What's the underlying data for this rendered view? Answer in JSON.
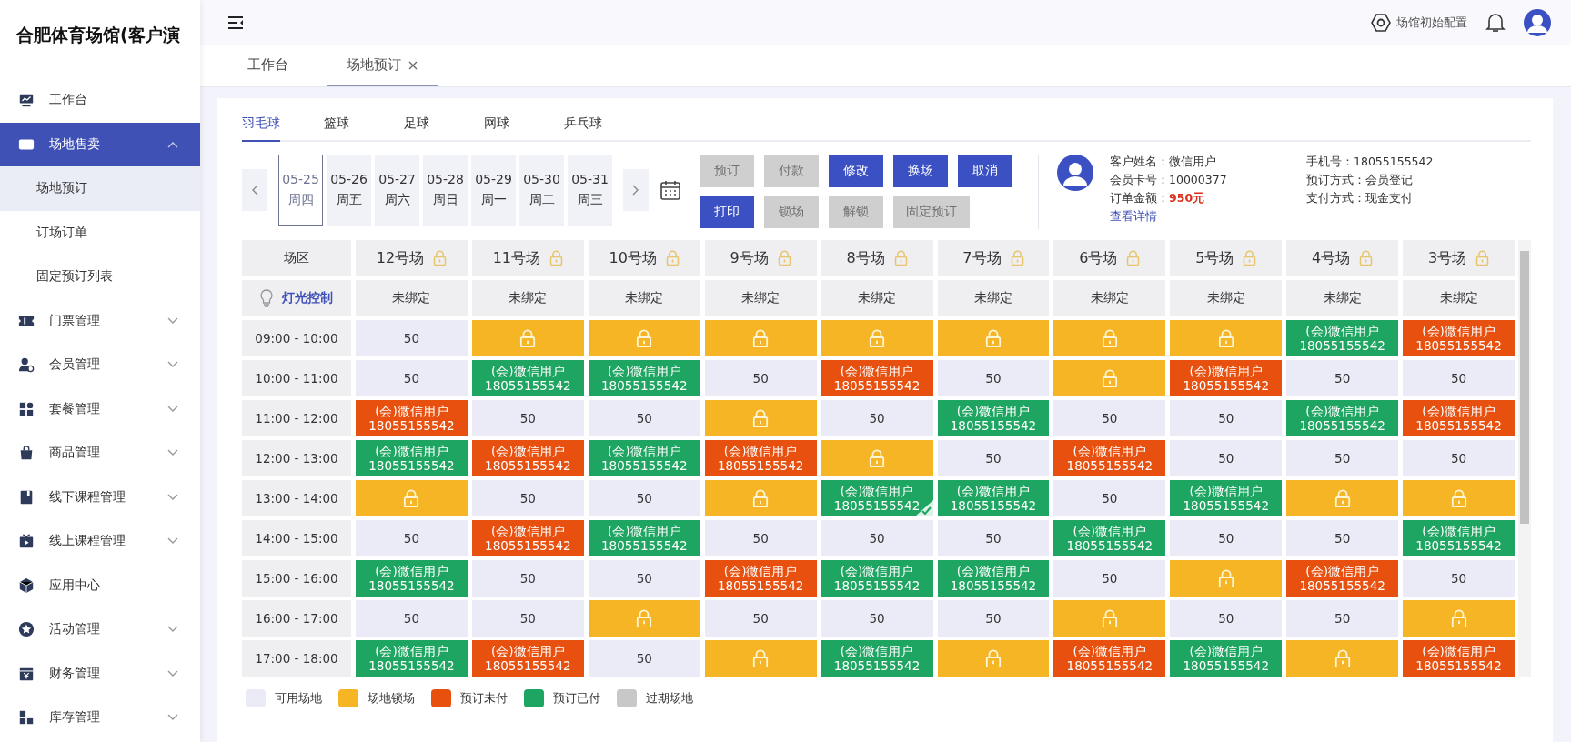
{
  "sidebar": {
    "title": "合肥体育场馆(客户演",
    "items": [
      {
        "label": "工作台",
        "selected": false
      },
      {
        "label": "场地售卖",
        "selected": true,
        "expanded": true,
        "children": [
          {
            "label": "场地预订",
            "selected": true
          },
          {
            "label": "订场订单",
            "selected": false
          },
          {
            "label": "固定预订列表",
            "selected": false
          }
        ]
      },
      {
        "label": "门票管理",
        "selected": false,
        "expanded": false
      },
      {
        "label": "会员管理",
        "selected": false,
        "expanded": false
      },
      {
        "label": "套餐管理",
        "selected": false,
        "expanded": false
      },
      {
        "label": "商品管理",
        "selected": false,
        "expanded": false
      },
      {
        "label": "线下课程管理",
        "selected": false,
        "expanded": false
      },
      {
        "label": "线上课程管理",
        "selected": false,
        "expanded": false
      },
      {
        "label": "应用中心",
        "selected": false
      },
      {
        "label": "活动管理",
        "selected": false,
        "expanded": false
      },
      {
        "label": "财务管理",
        "selected": false,
        "expanded": false
      },
      {
        "label": "库存管理",
        "selected": false,
        "expanded": false
      }
    ]
  },
  "header": {
    "config_label": "场馆初始配置"
  },
  "page_tabs": [
    {
      "label": "工作台",
      "selected": false,
      "closable": false
    },
    {
      "label": "场地预订",
      "selected": true,
      "closable": true
    }
  ],
  "sport_tabs": [
    {
      "label": "羽毛球",
      "selected": true
    },
    {
      "label": "篮球",
      "selected": false
    },
    {
      "label": "足球",
      "selected": false
    },
    {
      "label": "网球",
      "selected": false
    },
    {
      "label": "乒乓球",
      "selected": false
    }
  ],
  "dates": [
    {
      "date": "05-25",
      "weekday": "周四",
      "selected": true
    },
    {
      "date": "05-26",
      "weekday": "周五",
      "selected": false
    },
    {
      "date": "05-27",
      "weekday": "周六",
      "selected": false
    },
    {
      "date": "05-28",
      "weekday": "周日",
      "selected": false
    },
    {
      "date": "05-29",
      "weekday": "周一",
      "selected": false
    },
    {
      "date": "05-30",
      "weekday": "周二",
      "selected": false
    },
    {
      "date": "05-31",
      "weekday": "周三",
      "selected": false
    }
  ],
  "actions": [
    [
      {
        "label": "预订",
        "disabled": true
      },
      {
        "label": "付款",
        "disabled": true
      },
      {
        "label": "修改",
        "disabled": false
      },
      {
        "label": "换场",
        "disabled": false
      },
      {
        "label": "取消",
        "disabled": false
      }
    ],
    [
      {
        "label": "打印",
        "disabled": false
      },
      {
        "label": "锁场",
        "disabled": true
      },
      {
        "label": "解锁",
        "disabled": true
      },
      {
        "label": "固定预订",
        "disabled": true
      }
    ]
  ],
  "customer": {
    "left": [
      {
        "label": "客户姓名：",
        "value": "微信用户"
      },
      {
        "label": "会员卡号：",
        "value": "10000377"
      },
      {
        "label": "订单金额：",
        "value": "950元",
        "kind": "amount"
      }
    ],
    "right": [
      {
        "label": "手机号：",
        "value": "18055155542"
      },
      {
        "label": "预订方式：",
        "value": "会员登记"
      },
      {
        "label": "支付方式：",
        "value": "现金支付"
      }
    ],
    "link": "查看详情"
  },
  "grid": {
    "corner": "场区",
    "columns": [
      "12号场",
      "11号场",
      "10号场",
      "9号场",
      "8号场",
      "7号场",
      "6号场",
      "5号场",
      "4号场",
      "3号场"
    ],
    "light_label": "灯光控制",
    "bindings": [
      "未绑定",
      "未绑定",
      "未绑定",
      "未绑定",
      "未绑定",
      "未绑定",
      "未绑定",
      "未绑定",
      "未绑定",
      "未绑定"
    ],
    "rows": [
      {
        "time": "09:00 - 10:00",
        "cells": [
          {
            "kind": "available",
            "price": "50",
            "selected": false
          },
          {
            "kind": "locked",
            "selected": false
          },
          {
            "kind": "locked",
            "selected": false
          },
          {
            "kind": "locked",
            "selected": false
          },
          {
            "kind": "locked",
            "selected": false
          },
          {
            "kind": "locked",
            "selected": false
          },
          {
            "kind": "locked",
            "selected": false
          },
          {
            "kind": "locked",
            "selected": false
          },
          {
            "kind": "paid",
            "name": "(会)微信用户",
            "phone": "18055155542",
            "selected": false
          },
          {
            "kind": "unpaid",
            "name": "(会)微信用户",
            "phone": "18055155542",
            "selected": false
          }
        ]
      },
      {
        "time": "10:00 - 11:00",
        "cells": [
          {
            "kind": "available",
            "price": "50",
            "selected": false
          },
          {
            "kind": "paid",
            "name": "(会)微信用户",
            "phone": "18055155542",
            "selected": false
          },
          {
            "kind": "paid",
            "name": "(会)微信用户",
            "phone": "18055155542",
            "selected": false
          },
          {
            "kind": "available",
            "price": "50",
            "selected": false
          },
          {
            "kind": "unpaid",
            "name": "(会)微信用户",
            "phone": "18055155542",
            "selected": false
          },
          {
            "kind": "available",
            "price": "50",
            "selected": false
          },
          {
            "kind": "locked",
            "selected": false
          },
          {
            "kind": "unpaid",
            "name": "(会)微信用户",
            "phone": "18055155542",
            "selected": false
          },
          {
            "kind": "available",
            "price": "50",
            "selected": false
          },
          {
            "kind": "available",
            "price": "50",
            "selected": false
          }
        ]
      },
      {
        "time": "11:00 - 12:00",
        "cells": [
          {
            "kind": "unpaid",
            "name": "(会)微信用户",
            "phone": "18055155542",
            "selected": false
          },
          {
            "kind": "available",
            "price": "50",
            "selected": false
          },
          {
            "kind": "available",
            "price": "50",
            "selected": false
          },
          {
            "kind": "locked",
            "selected": false
          },
          {
            "kind": "available",
            "price": "50",
            "selected": false
          },
          {
            "kind": "paid",
            "name": "(会)微信用户",
            "phone": "18055155542",
            "selected": false
          },
          {
            "kind": "available",
            "price": "50",
            "selected": false
          },
          {
            "kind": "available",
            "price": "50",
            "selected": false
          },
          {
            "kind": "paid",
            "name": "(会)微信用户",
            "phone": "18055155542",
            "selected": false
          },
          {
            "kind": "unpaid",
            "name": "(会)微信用户",
            "phone": "18055155542",
            "selected": false
          }
        ]
      },
      {
        "time": "12:00 - 13:00",
        "cells": [
          {
            "kind": "paid",
            "name": "(会)微信用户",
            "phone": "18055155542",
            "selected": false
          },
          {
            "kind": "unpaid",
            "name": "(会)微信用户",
            "phone": "18055155542",
            "selected": false
          },
          {
            "kind": "paid",
            "name": "(会)微信用户",
            "phone": "18055155542",
            "selected": false
          },
          {
            "kind": "unpaid",
            "name": "(会)微信用户",
            "phone": "18055155542",
            "selected": false
          },
          {
            "kind": "locked",
            "selected": false
          },
          {
            "kind": "available",
            "price": "50",
            "selected": false
          },
          {
            "kind": "unpaid",
            "name": "(会)微信用户",
            "phone": "18055155542",
            "selected": false
          },
          {
            "kind": "available",
            "price": "50",
            "selected": false
          },
          {
            "kind": "available",
            "price": "50",
            "selected": false
          },
          {
            "kind": "available",
            "price": "50",
            "selected": false
          }
        ]
      },
      {
        "time": "13:00 - 14:00",
        "cells": [
          {
            "kind": "locked",
            "selected": false
          },
          {
            "kind": "available",
            "price": "50",
            "selected": false
          },
          {
            "kind": "available",
            "price": "50",
            "selected": false
          },
          {
            "kind": "locked",
            "selected": false
          },
          {
            "kind": "paid",
            "name": "(会)微信用户",
            "phone": "18055155542",
            "selected": true
          },
          {
            "kind": "paid",
            "name": "(会)微信用户",
            "phone": "18055155542",
            "selected": false
          },
          {
            "kind": "available",
            "price": "50",
            "selected": false
          },
          {
            "kind": "paid",
            "name": "(会)微信用户",
            "phone": "18055155542",
            "selected": false
          },
          {
            "kind": "locked",
            "selected": false
          },
          {
            "kind": "locked",
            "selected": false
          }
        ]
      },
      {
        "time": "14:00 - 15:00",
        "cells": [
          {
            "kind": "available",
            "price": "50",
            "selected": false
          },
          {
            "kind": "unpaid",
            "name": "(会)微信用户",
            "phone": "18055155542",
            "selected": false
          },
          {
            "kind": "paid",
            "name": "(会)微信用户",
            "phone": "18055155542",
            "selected": false
          },
          {
            "kind": "available",
            "price": "50",
            "selected": false
          },
          {
            "kind": "available",
            "price": "50",
            "selected": false
          },
          {
            "kind": "available",
            "price": "50",
            "selected": false
          },
          {
            "kind": "paid",
            "name": "(会)微信用户",
            "phone": "18055155542",
            "selected": false
          },
          {
            "kind": "available",
            "price": "50",
            "selected": false
          },
          {
            "kind": "available",
            "price": "50",
            "selected": false
          },
          {
            "kind": "paid",
            "name": "(会)微信用户",
            "phone": "18055155542",
            "selected": false
          }
        ]
      },
      {
        "time": "15:00 - 16:00",
        "cells": [
          {
            "kind": "paid",
            "name": "(会)微信用户",
            "phone": "18055155542",
            "selected": false
          },
          {
            "kind": "available",
            "price": "50",
            "selected": false
          },
          {
            "kind": "available",
            "price": "50",
            "selected": false
          },
          {
            "kind": "unpaid",
            "name": "(会)微信用户",
            "phone": "18055155542",
            "selected": false
          },
          {
            "kind": "paid",
            "name": "(会)微信用户",
            "phone": "18055155542",
            "selected": false
          },
          {
            "kind": "paid",
            "name": "(会)微信用户",
            "phone": "18055155542",
            "selected": false
          },
          {
            "kind": "available",
            "price": "50",
            "selected": false
          },
          {
            "kind": "locked",
            "selected": false
          },
          {
            "kind": "unpaid",
            "name": "(会)微信用户",
            "phone": "18055155542",
            "selected": false
          },
          {
            "kind": "available",
            "price": "50",
            "selected": false
          }
        ]
      },
      {
        "time": "16:00 - 17:00",
        "cells": [
          {
            "kind": "available",
            "price": "50",
            "selected": false
          },
          {
            "kind": "available",
            "price": "50",
            "selected": false
          },
          {
            "kind": "locked",
            "selected": false
          },
          {
            "kind": "available",
            "price": "50",
            "selected": false
          },
          {
            "kind": "available",
            "price": "50",
            "selected": false
          },
          {
            "kind": "available",
            "price": "50",
            "selected": false
          },
          {
            "kind": "locked",
            "selected": false
          },
          {
            "kind": "available",
            "price": "50",
            "selected": false
          },
          {
            "kind": "available",
            "price": "50",
            "selected": false
          },
          {
            "kind": "locked",
            "selected": false
          }
        ]
      },
      {
        "time": "17:00 - 18:00",
        "cells": [
          {
            "kind": "paid",
            "name": "(会)微信用户",
            "phone": "18055155542",
            "selected": false
          },
          {
            "kind": "unpaid",
            "name": "(会)微信用户",
            "phone": "18055155542",
            "selected": false
          },
          {
            "kind": "available",
            "price": "50",
            "selected": false
          },
          {
            "kind": "locked",
            "selected": false
          },
          {
            "kind": "paid",
            "name": "(会)微信用户",
            "phone": "18055155542",
            "selected": false
          },
          {
            "kind": "locked",
            "selected": false
          },
          {
            "kind": "unpaid",
            "name": "(会)微信用户",
            "phone": "18055155542",
            "selected": false
          },
          {
            "kind": "paid",
            "name": "(会)微信用户",
            "phone": "18055155542",
            "selected": false
          },
          {
            "kind": "locked",
            "selected": false
          },
          {
            "kind": "unpaid",
            "name": "(会)微信用户",
            "phone": "18055155542",
            "selected": false
          }
        ]
      }
    ]
  },
  "legend": [
    {
      "label": "可用场地",
      "color": "#ebebf7"
    },
    {
      "label": "场地锁场",
      "color": "#f5b525"
    },
    {
      "label": "预订未付",
      "color": "#e8500f"
    },
    {
      "label": "预订已付",
      "color": "#1fa562"
    },
    {
      "label": "过期场地",
      "color": "#c8c8c8"
    }
  ]
}
